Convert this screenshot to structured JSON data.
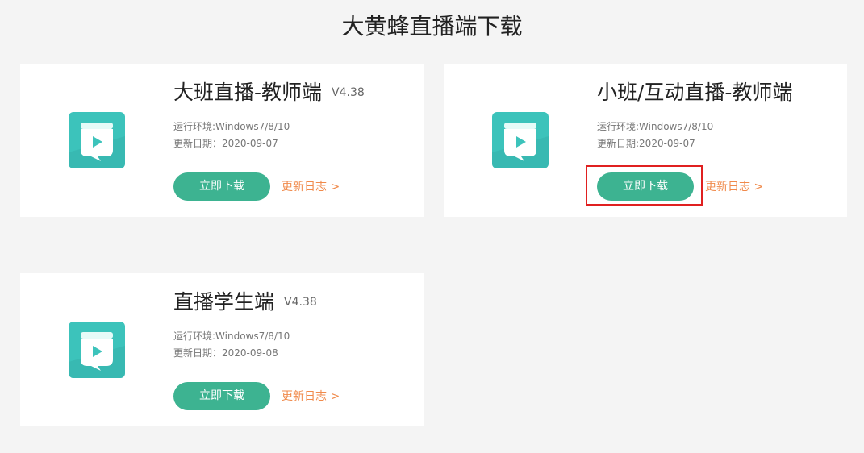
{
  "page": {
    "title": "大黄蜂直播端下载"
  },
  "theme": {
    "accent": "#3db391",
    "link": "#f08a4b",
    "icon_bg": "#3cc3bb",
    "highlight": "#e02020"
  },
  "cards": [
    {
      "icon": "book-play-icon",
      "name": "大班直播-教师端",
      "version": "V4.38",
      "env": "运行环境:Windows7/8/10",
      "date": "更新日期：2020-09-07",
      "download_label": "立即下载",
      "changelog_label": "更新日志 >"
    },
    {
      "icon": "book-play-icon",
      "name": "小班/互动直播-教师端",
      "version": "",
      "env": "运行环境:Windows7/8/10",
      "date": "更新日期:2020-09-07",
      "download_label": "立即下载",
      "changelog_label": "更新日志 >"
    },
    {
      "icon": "book-play-icon",
      "name": "直播学生端",
      "version": "V4.38",
      "env": "运行环境:Windows7/8/10",
      "date": "更新日期：2020-09-08",
      "download_label": "立即下载",
      "changelog_label": "更新日志 >"
    }
  ]
}
